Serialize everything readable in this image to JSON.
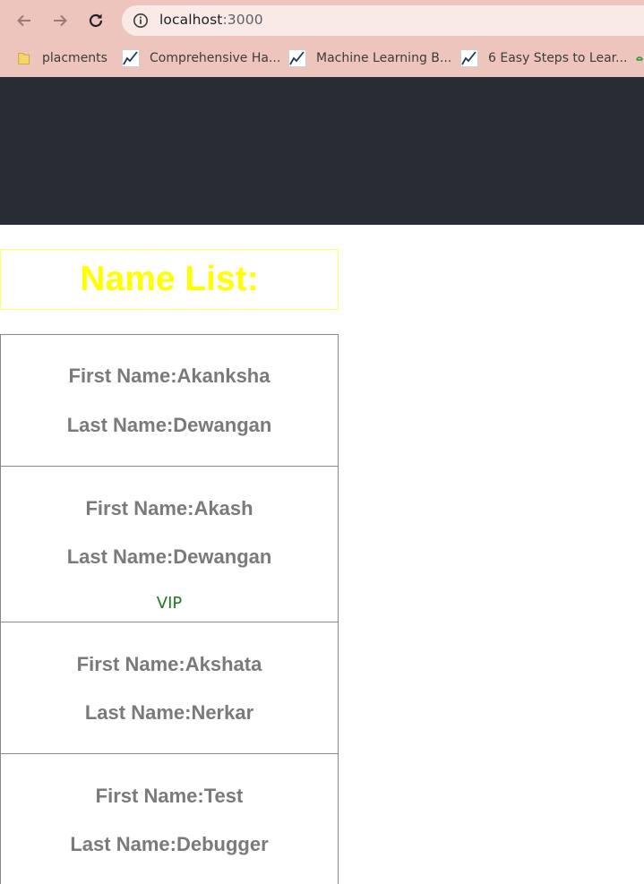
{
  "browser": {
    "url_host": "localhost",
    "url_port": ":3000",
    "bookmarks": [
      {
        "label": "placments",
        "icon": "folder-icon"
      },
      {
        "label": "Comprehensive Ha...",
        "icon": "chart-favicon-icon"
      },
      {
        "label": "Machine Learning B...",
        "icon": "chart-favicon-icon"
      },
      {
        "label": "6 Easy Steps to Lear...",
        "icon": "chart-favicon-icon"
      }
    ]
  },
  "page": {
    "header_color": "#282c34",
    "title": "Name List:",
    "title_color": "#ffff00",
    "people": [
      {
        "first": "First Name:Akanksha",
        "last": "Last Name:Dewangan",
        "badge": ""
      },
      {
        "first": "First Name:Akash",
        "last": "Last Name:Dewangan",
        "badge": "VIP"
      },
      {
        "first": "First Name:Akshata",
        "last": "Last Name:Nerkar",
        "badge": ""
      },
      {
        "first": "First Name:Test",
        "last": "Last Name:Debugger",
        "badge": ""
      }
    ]
  }
}
